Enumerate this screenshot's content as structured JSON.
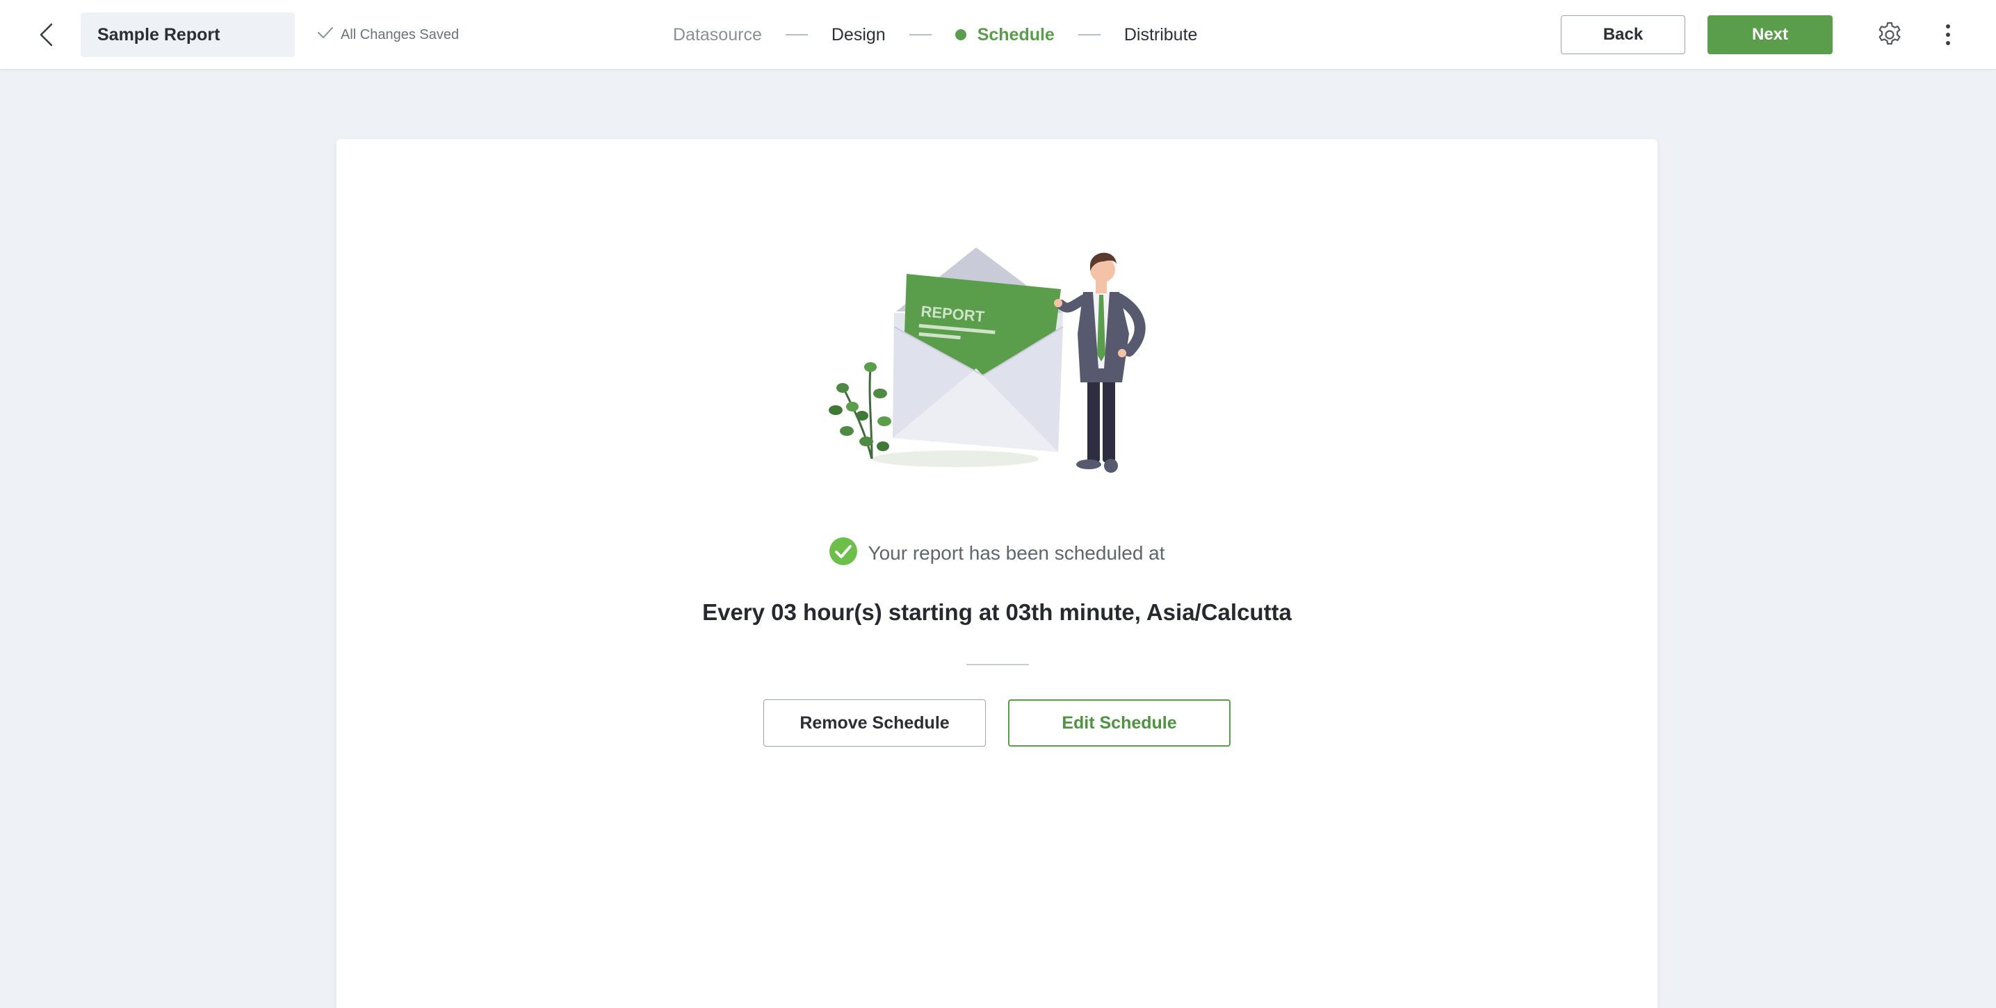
{
  "header": {
    "report_name": "Sample Report",
    "save_status": "All Changes Saved",
    "steps": [
      {
        "label": "Datasource",
        "state": "completed"
      },
      {
        "label": "Design",
        "state": "completed"
      },
      {
        "label": "Schedule",
        "state": "active"
      },
      {
        "label": "Distribute",
        "state": "upcoming"
      }
    ],
    "back_label": "Back",
    "next_label": "Next",
    "icons": {
      "back": "chevron-left-icon",
      "saved": "check-icon",
      "settings": "gear-icon",
      "more": "more-vertical-icon"
    }
  },
  "illustration": {
    "envelope_card_label": "REPORT"
  },
  "schedule": {
    "success_message": "Your report has been scheduled at",
    "description": "Every 03 hour(s) starting at 03th minute, Asia/Calcutta",
    "remove_label": "Remove Schedule",
    "edit_label": "Edit Schedule"
  },
  "colors": {
    "accent": "#5a9e4b",
    "background": "#eef1f5",
    "card": "#ffffff"
  }
}
